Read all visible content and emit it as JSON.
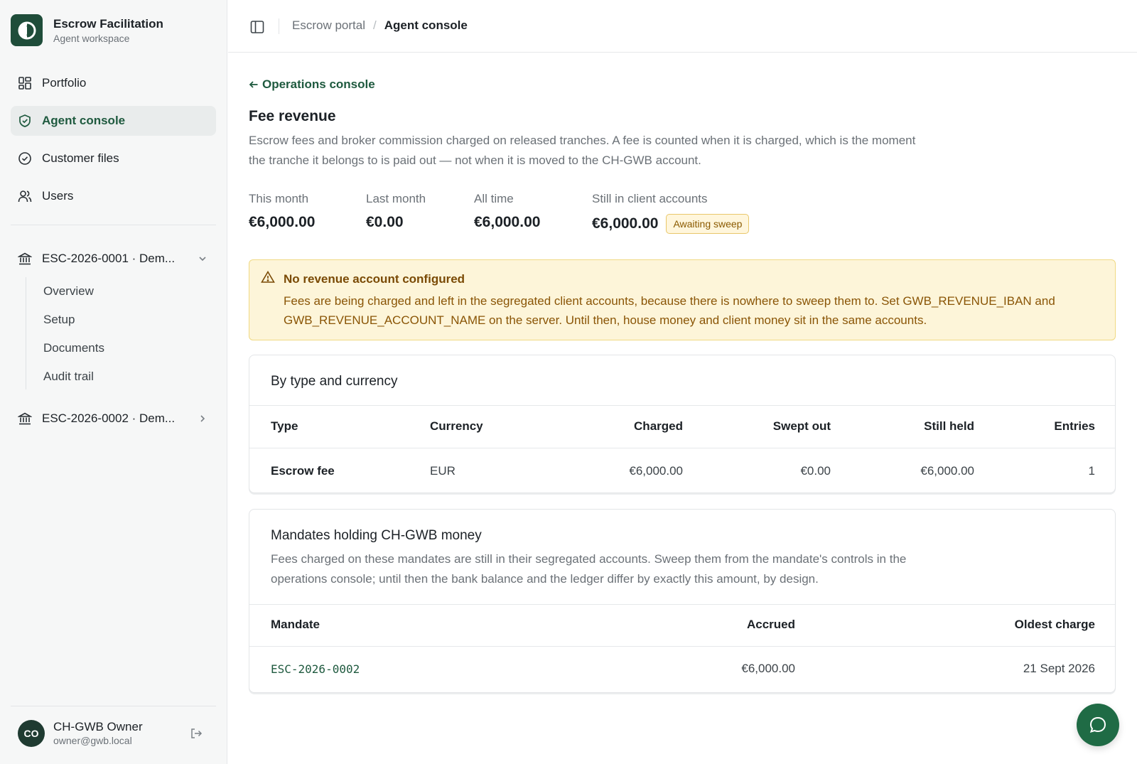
{
  "brand": {
    "title": "Escrow Facilitation",
    "subtitle": "Agent workspace"
  },
  "nav": {
    "items": [
      {
        "label": "Portfolio",
        "icon": "grid-icon"
      },
      {
        "label": "Agent console",
        "icon": "shield-check-icon",
        "active": true
      },
      {
        "label": "Customer files",
        "icon": "check-circle-icon"
      },
      {
        "label": "Users",
        "icon": "users-icon"
      }
    ]
  },
  "mandates": [
    {
      "label": "ESC-2026-0001 · Dem...",
      "expanded": true
    },
    {
      "label": "ESC-2026-0002 · Dem...",
      "expanded": false
    }
  ],
  "subnav": {
    "items": [
      "Overview",
      "Setup",
      "Documents",
      "Audit trail"
    ]
  },
  "user": {
    "initials": "CO",
    "name": "CH-GWB Owner",
    "email": "owner@gwb.local"
  },
  "breadcrumb": {
    "parent": "Escrow portal",
    "separator": "/",
    "current": "Agent console"
  },
  "page": {
    "back_label": "Operations console",
    "title": "Fee revenue",
    "description": "Escrow fees and broker commission charged on released tranches. A fee is counted when it is charged, which is the moment the tranche it belongs to is paid out — not when it is moved to the CH-GWB account."
  },
  "stats": [
    {
      "label": "This month",
      "value": "€6,000.00"
    },
    {
      "label": "Last month",
      "value": "€0.00"
    },
    {
      "label": "All time",
      "value": "€6,000.00"
    },
    {
      "label": "Still in client accounts",
      "value": "€6,000.00",
      "badge": "Awaiting sweep"
    }
  ],
  "alert": {
    "title": "No revenue account configured",
    "body": "Fees are being charged and left in the segregated client accounts, because there is nowhere to sweep them to. Set GWB_REVENUE_IBAN and GWB_REVENUE_ACCOUNT_NAME on the server. Until then, house money and client money sit in the same accounts."
  },
  "by_type": {
    "title": "By type and currency",
    "columns": [
      "Type",
      "Currency",
      "Charged",
      "Swept out",
      "Still held",
      "Entries"
    ],
    "rows": [
      {
        "type": "Escrow fee",
        "currency": "EUR",
        "charged": "€6,000.00",
        "swept_out": "€0.00",
        "still_held": "€6,000.00",
        "entries": "1"
      }
    ]
  },
  "holding": {
    "title": "Mandates holding CH-GWB money",
    "description": "Fees charged on these mandates are still in their segregated accounts. Sweep them from the mandate's controls in the operations console; until then the bank balance and the ledger differ by exactly this amount, by design.",
    "columns": [
      "Mandate",
      "Accrued",
      "Oldest charge"
    ],
    "rows": [
      {
        "mandate": "ESC-2026-0002",
        "accrued": "€6,000.00",
        "oldest_charge": "21 Sept 2026"
      }
    ]
  },
  "colors": {
    "accent": "#1f5a3f",
    "brand_logo": "#1f4d3a",
    "warning_bg": "#fdf5d9",
    "fab": "#1f6b45"
  },
  "fab": {
    "icon": "chat-icon"
  }
}
